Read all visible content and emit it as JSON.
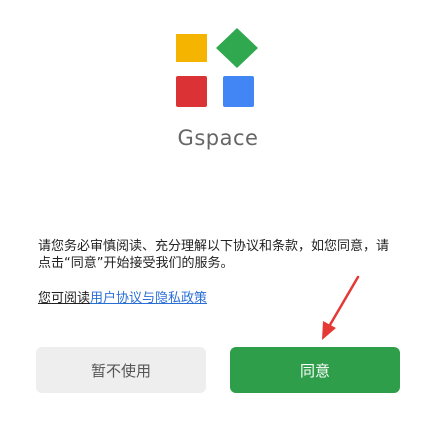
{
  "app": {
    "name": "Gspace"
  },
  "logo": {
    "colors": {
      "yellow": "#F4B400",
      "green": "#2FA84F",
      "red": "#DB3236",
      "blue": "#4285F4"
    }
  },
  "dialog": {
    "message": "请您务必审慎阅读、充分理解以下协议和条款，如您同意，请点击“同意”开始接受我们的服务。",
    "link_lead": "您可阅读",
    "link_text": "用户协议与隐私政策",
    "decline_label": "暂不使用",
    "agree_label": "同意"
  },
  "annotation": {
    "arrow_color": "#E53935",
    "arrow_icon": "red-arrow-icon"
  }
}
